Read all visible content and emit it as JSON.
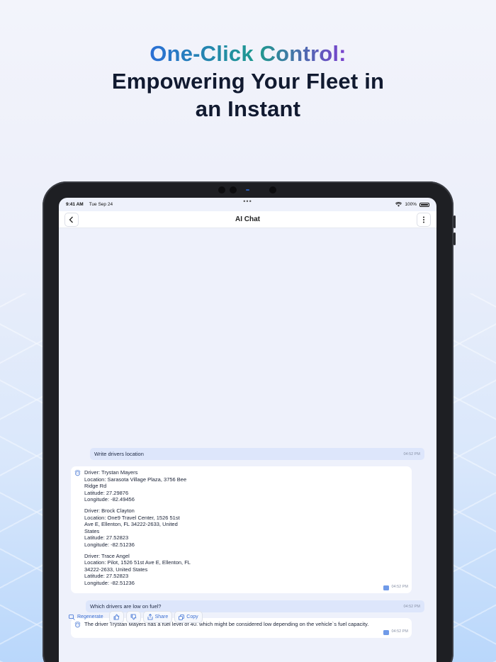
{
  "promo": {
    "headline_accent": "One-Click Control:",
    "headline_line2": "Empowering Your Fleet in",
    "headline_line3": "an Instant"
  },
  "status_bar": {
    "time": "9:41 AM",
    "date": "Tue Sep 24",
    "dots": "•••",
    "battery": "100%"
  },
  "header": {
    "title": "AI Chat"
  },
  "messages": {
    "q1": {
      "text": "Write drivers location",
      "time": "04:52 PM"
    },
    "a1": {
      "drivers": [
        {
          "driver": "Driver: Trystan Mayers",
          "location": "Location: Sarasota Village Plaza, 3756 Bee",
          "location2": "Ridge Rd",
          "location3": "",
          "latitude": "Latitude: 27.29876",
          "longitude": "Longitude: -82.49456"
        },
        {
          "driver": "Driver: Brock Clayton",
          "location": "Location: One9 Travel Center, 1526 51st",
          "location2": "Ave E, Ellenton, FL 34222-2633, United",
          "location3": "States",
          "latitude": "Latitude: 27.52823",
          "longitude": "Longitude: -82.51236"
        },
        {
          "driver": "Driver: Trace Angel",
          "location": "Location: Pilot, 1526 51st Ave E, Ellenton, FL",
          "location2": "34222-2633, United States",
          "location3": "",
          "latitude": "Latitude: 27.52823",
          "longitude": "Longitude: -82.51236"
        }
      ],
      "time": "04:52 PM"
    },
    "q2": {
      "text": "Which drivers are low on fuel?",
      "time": "04:52 PM"
    },
    "a2": {
      "text": "The driver Trystan Mayers has a fuel level of 40. which might be considered low depending on the vehicle`s fuel capacity.",
      "time": "04:52 PM"
    }
  },
  "actions": {
    "regenerate": "Regenerate",
    "share": "Share",
    "copy": "Copy"
  },
  "icons": {
    "back": "chevron-left-icon",
    "menu": "more-vertical-icon",
    "ai": "ai-bot-icon",
    "thumbs_up": "thumbs-up-icon",
    "thumbs_down": "thumbs-down-icon"
  },
  "colors": {
    "accent_blue": "#2b6fd6",
    "accent_teal": "#1e9a8e",
    "accent_purple": "#7b3fcf",
    "user_bubble": "#dde6fb",
    "action_text": "#3b6fd3"
  }
}
